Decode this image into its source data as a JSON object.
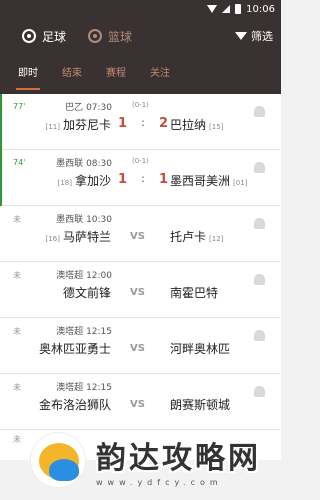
{
  "status_bar": {
    "time": "10:06"
  },
  "header": {
    "sports": [
      {
        "label": "足球",
        "icon": "football-icon",
        "active": true
      },
      {
        "label": "篮球",
        "icon": "basketball-icon",
        "active": false
      }
    ],
    "filter_label": "筛选"
  },
  "tabs": [
    {
      "label": "即时",
      "active": true
    },
    {
      "label": "结束",
      "active": false
    },
    {
      "label": "赛程",
      "active": false
    },
    {
      "label": "关注",
      "active": false
    }
  ],
  "matches": [
    {
      "state": "77'",
      "live": true,
      "league": "巴乙",
      "time": "07:30",
      "note": "(0-1)",
      "home_rank": "[11]",
      "home": "加芬尼卡",
      "home_score": "1",
      "away_score": "2",
      "away": "巴拉纳",
      "away_rank": "[15]"
    },
    {
      "state": "74'",
      "live": true,
      "league": "墨西联",
      "time": "08:30",
      "note": "(0-1)",
      "home_rank": "[18]",
      "home": "拿加沙",
      "home_score": "1",
      "away_score": "1",
      "away": "墨西哥美洲",
      "away_rank": "[01]"
    },
    {
      "state": "未",
      "live": false,
      "league": "墨西联",
      "time": "10:30",
      "note": "",
      "home_rank": "[16]",
      "home": "马萨特兰",
      "vs": "VS",
      "away": "托卢卡",
      "away_rank": "[12]"
    },
    {
      "state": "未",
      "live": false,
      "league": "澳塔超",
      "time": "12:00",
      "note": "",
      "home_rank": "",
      "home": "德文前锋",
      "vs": "VS",
      "away": "南霍巴特",
      "away_rank": ""
    },
    {
      "state": "未",
      "live": false,
      "league": "澳塔超",
      "time": "12:15",
      "note": "",
      "home_rank": "",
      "home": "奥林匹亚勇士",
      "vs": "VS",
      "away": "河畔奥林匹",
      "away_rank": ""
    },
    {
      "state": "未",
      "live": false,
      "league": "澳塔超",
      "time": "12:15",
      "note": "",
      "home_rank": "",
      "home": "金布洛治狮队",
      "vs": "VS",
      "away": "朗赛斯顿城",
      "away_rank": ""
    }
  ],
  "partial_row": {
    "state": "未"
  },
  "watermark": {
    "title": "韵达攻略网",
    "url": "www.ydfcy.com"
  }
}
